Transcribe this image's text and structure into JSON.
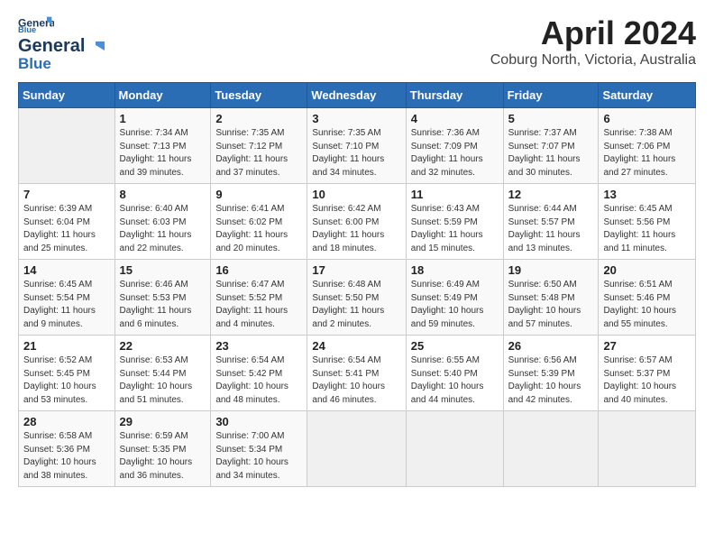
{
  "logo": {
    "line1": "General",
    "line2": "Blue"
  },
  "title": "April 2024",
  "subtitle": "Coburg North, Victoria, Australia",
  "weekdays": [
    "Sunday",
    "Monday",
    "Tuesday",
    "Wednesday",
    "Thursday",
    "Friday",
    "Saturday"
  ],
  "weeks": [
    [
      {
        "day": "",
        "sunrise": "",
        "sunset": "",
        "daylight": ""
      },
      {
        "day": "1",
        "sunrise": "Sunrise: 7:34 AM",
        "sunset": "Sunset: 7:13 PM",
        "daylight": "Daylight: 11 hours and 39 minutes."
      },
      {
        "day": "2",
        "sunrise": "Sunrise: 7:35 AM",
        "sunset": "Sunset: 7:12 PM",
        "daylight": "Daylight: 11 hours and 37 minutes."
      },
      {
        "day": "3",
        "sunrise": "Sunrise: 7:35 AM",
        "sunset": "Sunset: 7:10 PM",
        "daylight": "Daylight: 11 hours and 34 minutes."
      },
      {
        "day": "4",
        "sunrise": "Sunrise: 7:36 AM",
        "sunset": "Sunset: 7:09 PM",
        "daylight": "Daylight: 11 hours and 32 minutes."
      },
      {
        "day": "5",
        "sunrise": "Sunrise: 7:37 AM",
        "sunset": "Sunset: 7:07 PM",
        "daylight": "Daylight: 11 hours and 30 minutes."
      },
      {
        "day": "6",
        "sunrise": "Sunrise: 7:38 AM",
        "sunset": "Sunset: 7:06 PM",
        "daylight": "Daylight: 11 hours and 27 minutes."
      }
    ],
    [
      {
        "day": "7",
        "sunrise": "Sunrise: 6:39 AM",
        "sunset": "Sunset: 6:04 PM",
        "daylight": "Daylight: 11 hours and 25 minutes."
      },
      {
        "day": "8",
        "sunrise": "Sunrise: 6:40 AM",
        "sunset": "Sunset: 6:03 PM",
        "daylight": "Daylight: 11 hours and 22 minutes."
      },
      {
        "day": "9",
        "sunrise": "Sunrise: 6:41 AM",
        "sunset": "Sunset: 6:02 PM",
        "daylight": "Daylight: 11 hours and 20 minutes."
      },
      {
        "day": "10",
        "sunrise": "Sunrise: 6:42 AM",
        "sunset": "Sunset: 6:00 PM",
        "daylight": "Daylight: 11 hours and 18 minutes."
      },
      {
        "day": "11",
        "sunrise": "Sunrise: 6:43 AM",
        "sunset": "Sunset: 5:59 PM",
        "daylight": "Daylight: 11 hours and 15 minutes."
      },
      {
        "day": "12",
        "sunrise": "Sunrise: 6:44 AM",
        "sunset": "Sunset: 5:57 PM",
        "daylight": "Daylight: 11 hours and 13 minutes."
      },
      {
        "day": "13",
        "sunrise": "Sunrise: 6:45 AM",
        "sunset": "Sunset: 5:56 PM",
        "daylight": "Daylight: 11 hours and 11 minutes."
      }
    ],
    [
      {
        "day": "14",
        "sunrise": "Sunrise: 6:45 AM",
        "sunset": "Sunset: 5:54 PM",
        "daylight": "Daylight: 11 hours and 9 minutes."
      },
      {
        "day": "15",
        "sunrise": "Sunrise: 6:46 AM",
        "sunset": "Sunset: 5:53 PM",
        "daylight": "Daylight: 11 hours and 6 minutes."
      },
      {
        "day": "16",
        "sunrise": "Sunrise: 6:47 AM",
        "sunset": "Sunset: 5:52 PM",
        "daylight": "Daylight: 11 hours and 4 minutes."
      },
      {
        "day": "17",
        "sunrise": "Sunrise: 6:48 AM",
        "sunset": "Sunset: 5:50 PM",
        "daylight": "Daylight: 11 hours and 2 minutes."
      },
      {
        "day": "18",
        "sunrise": "Sunrise: 6:49 AM",
        "sunset": "Sunset: 5:49 PM",
        "daylight": "Daylight: 10 hours and 59 minutes."
      },
      {
        "day": "19",
        "sunrise": "Sunrise: 6:50 AM",
        "sunset": "Sunset: 5:48 PM",
        "daylight": "Daylight: 10 hours and 57 minutes."
      },
      {
        "day": "20",
        "sunrise": "Sunrise: 6:51 AM",
        "sunset": "Sunset: 5:46 PM",
        "daylight": "Daylight: 10 hours and 55 minutes."
      }
    ],
    [
      {
        "day": "21",
        "sunrise": "Sunrise: 6:52 AM",
        "sunset": "Sunset: 5:45 PM",
        "daylight": "Daylight: 10 hours and 53 minutes."
      },
      {
        "day": "22",
        "sunrise": "Sunrise: 6:53 AM",
        "sunset": "Sunset: 5:44 PM",
        "daylight": "Daylight: 10 hours and 51 minutes."
      },
      {
        "day": "23",
        "sunrise": "Sunrise: 6:54 AM",
        "sunset": "Sunset: 5:42 PM",
        "daylight": "Daylight: 10 hours and 48 minutes."
      },
      {
        "day": "24",
        "sunrise": "Sunrise: 6:54 AM",
        "sunset": "Sunset: 5:41 PM",
        "daylight": "Daylight: 10 hours and 46 minutes."
      },
      {
        "day": "25",
        "sunrise": "Sunrise: 6:55 AM",
        "sunset": "Sunset: 5:40 PM",
        "daylight": "Daylight: 10 hours and 44 minutes."
      },
      {
        "day": "26",
        "sunrise": "Sunrise: 6:56 AM",
        "sunset": "Sunset: 5:39 PM",
        "daylight": "Daylight: 10 hours and 42 minutes."
      },
      {
        "day": "27",
        "sunrise": "Sunrise: 6:57 AM",
        "sunset": "Sunset: 5:37 PM",
        "daylight": "Daylight: 10 hours and 40 minutes."
      }
    ],
    [
      {
        "day": "28",
        "sunrise": "Sunrise: 6:58 AM",
        "sunset": "Sunset: 5:36 PM",
        "daylight": "Daylight: 10 hours and 38 minutes."
      },
      {
        "day": "29",
        "sunrise": "Sunrise: 6:59 AM",
        "sunset": "Sunset: 5:35 PM",
        "daylight": "Daylight: 10 hours and 36 minutes."
      },
      {
        "day": "30",
        "sunrise": "Sunrise: 7:00 AM",
        "sunset": "Sunset: 5:34 PM",
        "daylight": "Daylight: 10 hours and 34 minutes."
      },
      {
        "day": "",
        "sunrise": "",
        "sunset": "",
        "daylight": ""
      },
      {
        "day": "",
        "sunrise": "",
        "sunset": "",
        "daylight": ""
      },
      {
        "day": "",
        "sunrise": "",
        "sunset": "",
        "daylight": ""
      },
      {
        "day": "",
        "sunrise": "",
        "sunset": "",
        "daylight": ""
      }
    ]
  ]
}
